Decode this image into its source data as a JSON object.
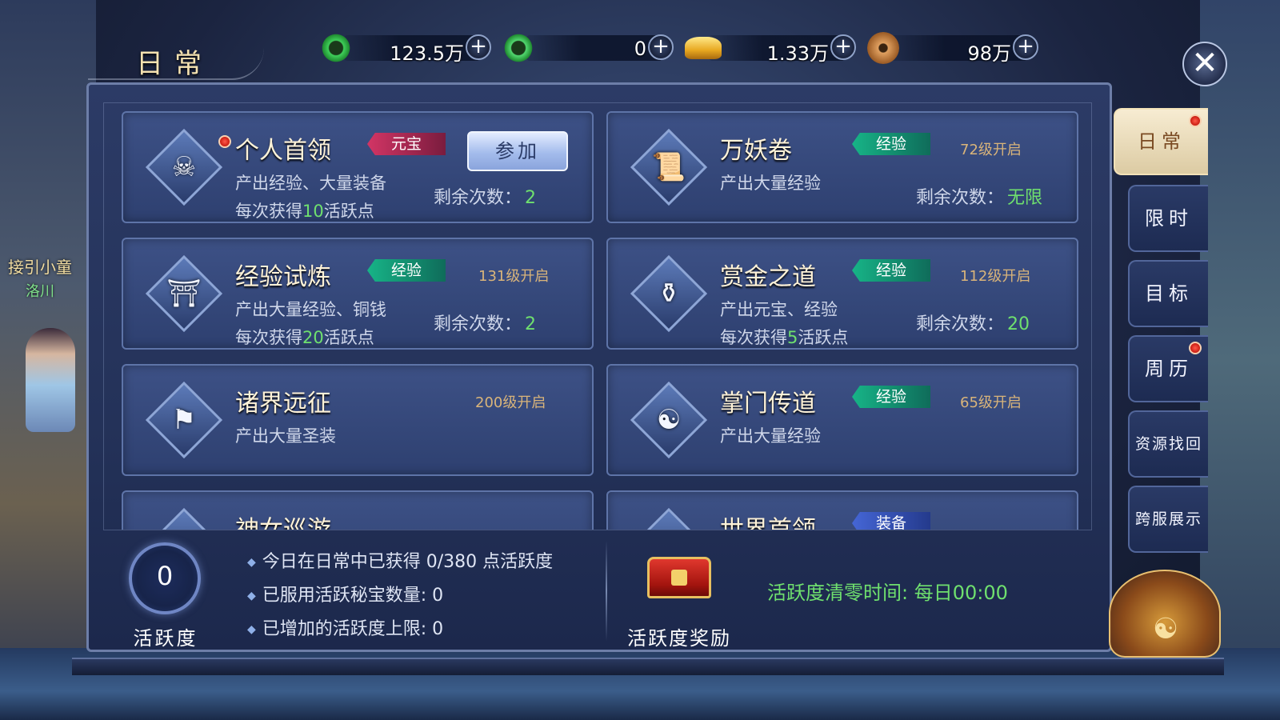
{
  "npc": {
    "name": "接引小童",
    "place": "洛川"
  },
  "window": {
    "title": "日常"
  },
  "currencies": [
    {
      "icon": "jade-ring-icon",
      "value": "123.5万"
    },
    {
      "icon": "bound-jade-ring-icon",
      "value": "0"
    },
    {
      "icon": "gold-ingot-icon",
      "value": "1.33万"
    },
    {
      "icon": "copper-coin-icon",
      "value": "98万"
    }
  ],
  "activities": [
    {
      "name": "个人首领",
      "tag": "元宝",
      "tag_type": "gold",
      "desc": "产出经验、大量装备",
      "gain_prefix": "每次获得",
      "gain_points": "10",
      "gain_suffix": "活跃点",
      "remain_label": "剩余次数：",
      "remain": "2",
      "button": "参加",
      "red_dot": true
    },
    {
      "name": "万妖卷",
      "tag": "经验",
      "tag_type": "exp",
      "level": "72级开启",
      "desc": "产出大量经验",
      "remain_label": "剩余次数：",
      "remain": "无限"
    },
    {
      "name": "经验试炼",
      "tag": "经验",
      "tag_type": "exp",
      "level": "131级开启",
      "desc": "产出大量经验、铜钱",
      "gain_prefix": "每次获得",
      "gain_points": "20",
      "gain_suffix": "活跃点",
      "remain_label": "剩余次数：",
      "remain": "2"
    },
    {
      "name": "赏金之道",
      "tag": "经验",
      "tag_type": "exp",
      "level": "112级开启",
      "desc": "产出元宝、经验",
      "gain_prefix": "每次获得",
      "gain_points": "5",
      "gain_suffix": "活跃点",
      "remain_label": "剩余次数：",
      "remain": "20"
    },
    {
      "name": "诸界远征",
      "level": "200级开启",
      "desc": "产出大量圣装"
    },
    {
      "name": "掌门传道",
      "tag": "经验",
      "tag_type": "exp",
      "level": "65级开启",
      "desc": "产出大量经验"
    },
    {
      "name": "神女巡游"
    },
    {
      "name": "世界首领",
      "tag": "装备",
      "tag_type": "gear"
    }
  ],
  "activity": {
    "value": "0",
    "label": "活跃度",
    "lines": [
      "今日在日常中已获得 0/380 点活跃度",
      "已服用活跃秘宝数量:   0",
      "已增加的活跃度上限: 0"
    ],
    "reward_label": "活跃度奖励",
    "reset_time": "活跃度清零时间:   每日00:00"
  },
  "tabs": [
    {
      "label": "日常",
      "active": true,
      "red_dot": true
    },
    {
      "label": "限时"
    },
    {
      "label": "目标"
    },
    {
      "label": "周历",
      "red_dot": true
    },
    {
      "label": "资源找回"
    },
    {
      "label": "跨服展示"
    }
  ],
  "colors": {
    "highlight_green": "#6fe06e",
    "panel_blue": "#2c3b66",
    "tag_exp": "#17b487",
    "tag_gold": "#d23565"
  }
}
